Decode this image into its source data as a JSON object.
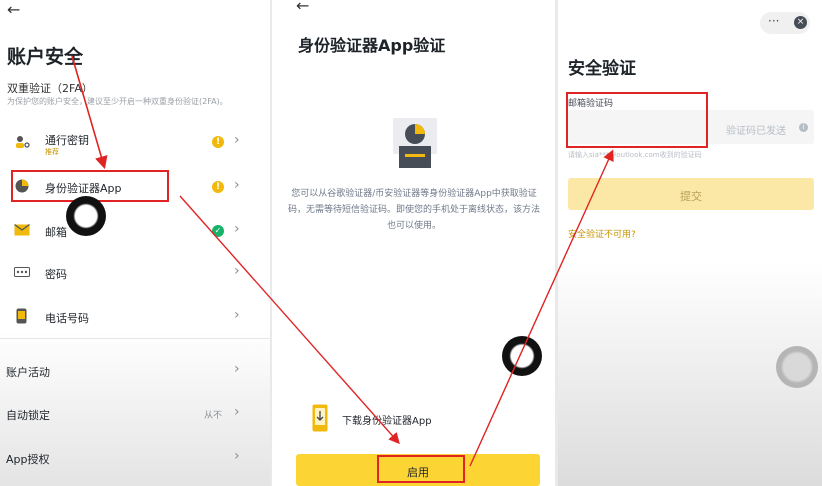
{
  "panel1": {
    "title": "账户安全",
    "section_title": "双重验证（2FA）",
    "section_desc": "为保护您的账户安全，建议至少开启一种双重身份验证(2FA)。",
    "items": [
      {
        "label": "通行密钥",
        "tag": "推荐",
        "icon": "passkey-icon",
        "status": "warning"
      },
      {
        "label": "身份验证器App",
        "icon": "authenticator-icon",
        "status": "warning"
      },
      {
        "label": "邮箱",
        "icon": "mail-icon",
        "status": "enabled"
      },
      {
        "label": "密码",
        "icon": "password-icon"
      },
      {
        "label": "电话号码",
        "icon": "phone-icon"
      }
    ],
    "more": [
      {
        "label": "账户活动"
      },
      {
        "label": "自动锁定",
        "value": "从不"
      },
      {
        "label": "App授权"
      }
    ]
  },
  "panel2": {
    "title": "身份验证器App验证",
    "description": "您可以从谷歌验证器/币安验证器等身份验证器App中获取验证码，无需等待短信验证码。即使您的手机处于离线状态，该方法也可以使用。",
    "download_label": "下载身份验证器App",
    "enable_button": "启用"
  },
  "panel3": {
    "title": "安全验证",
    "field_label": "邮箱验证码",
    "send_status": "验证码已发送",
    "hint": "请输入sia***@outlook.com收到的验证码",
    "submit_label": "提交",
    "unavailable_link": "安全验证不可用?"
  },
  "colors": {
    "accent": "#f0b90b",
    "annotation": "#e02424",
    "success": "#17b26a"
  }
}
